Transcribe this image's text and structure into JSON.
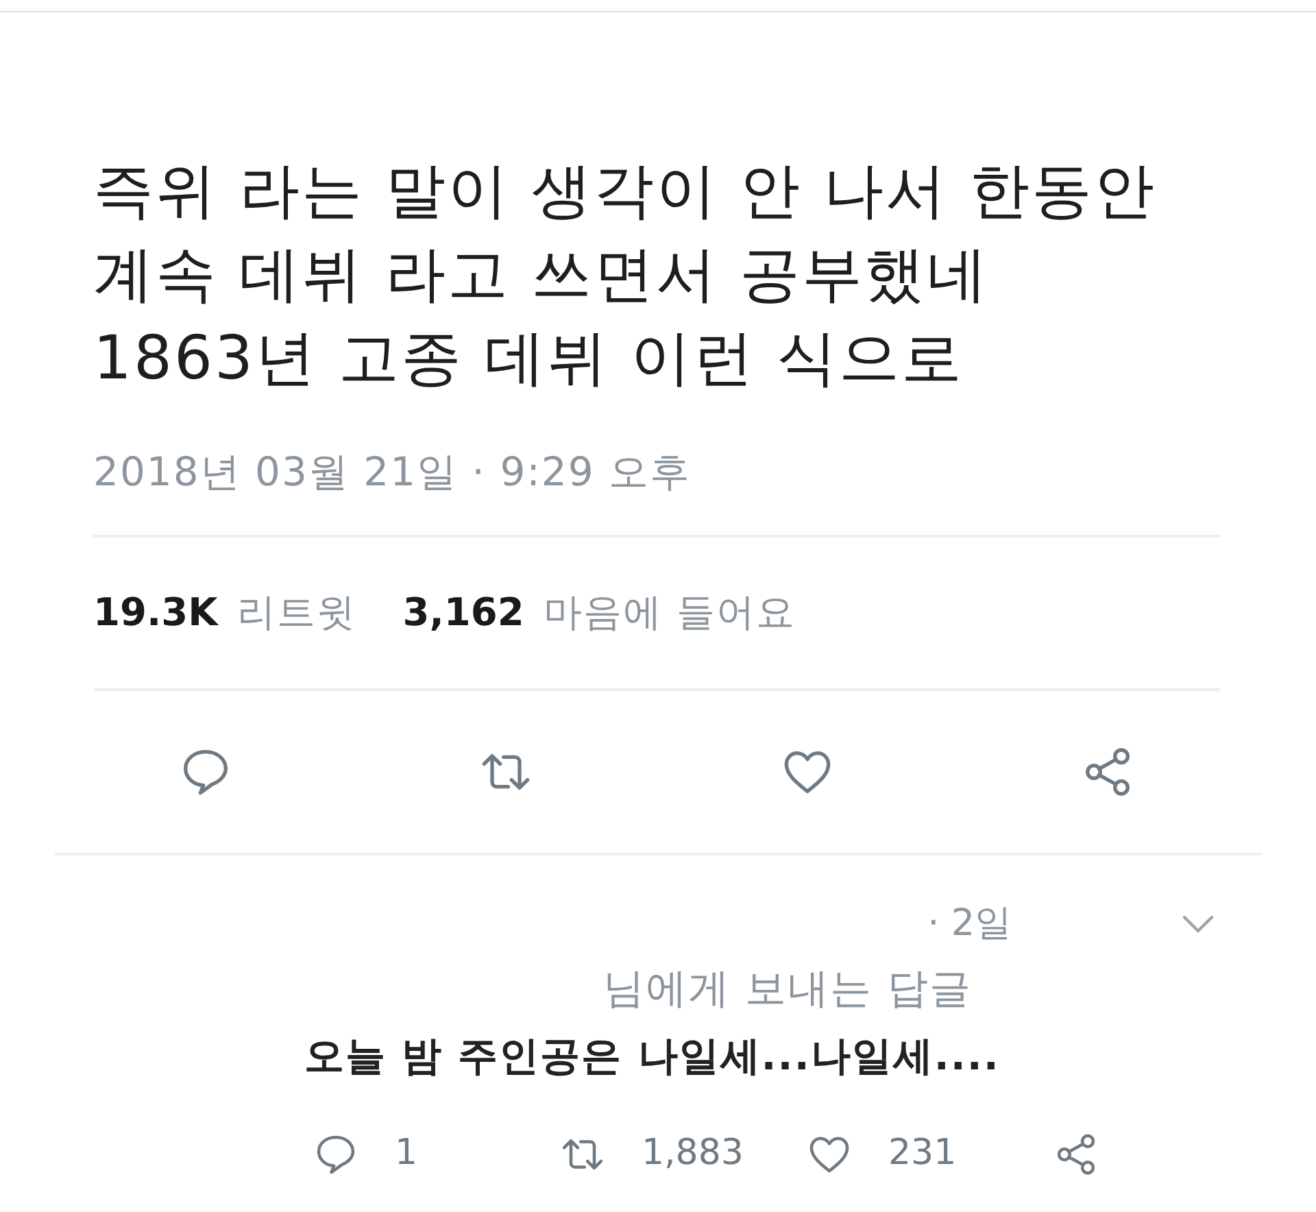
{
  "tweet": {
    "text": "즉위 라는 말이 생각이 안 나서 한동안\n계속 데뷔 라고 쓰면서 공부했네\n1863년 고종 데뷔 이런 식으로",
    "timestamp": "2018년 03월 21일 · 9:29 오후",
    "stats": [
      {
        "count": "19.3K",
        "label": "리트윗"
      },
      {
        "count": "3,162",
        "label": "마음에 들어요"
      }
    ],
    "actions": [
      {
        "kind": "reply"
      },
      {
        "kind": "retweet"
      },
      {
        "kind": "like"
      },
      {
        "kind": "share"
      }
    ]
  },
  "reply": {
    "time": "· 2일",
    "reply_to": "님에게 보내는 답글",
    "text": "오늘 밤 주인공은 나일세...나일세....",
    "actions": [
      {
        "kind": "reply",
        "count": "1"
      },
      {
        "kind": "retweet",
        "count": "1,883"
      },
      {
        "kind": "like",
        "count": "231"
      },
      {
        "kind": "share"
      }
    ]
  }
}
